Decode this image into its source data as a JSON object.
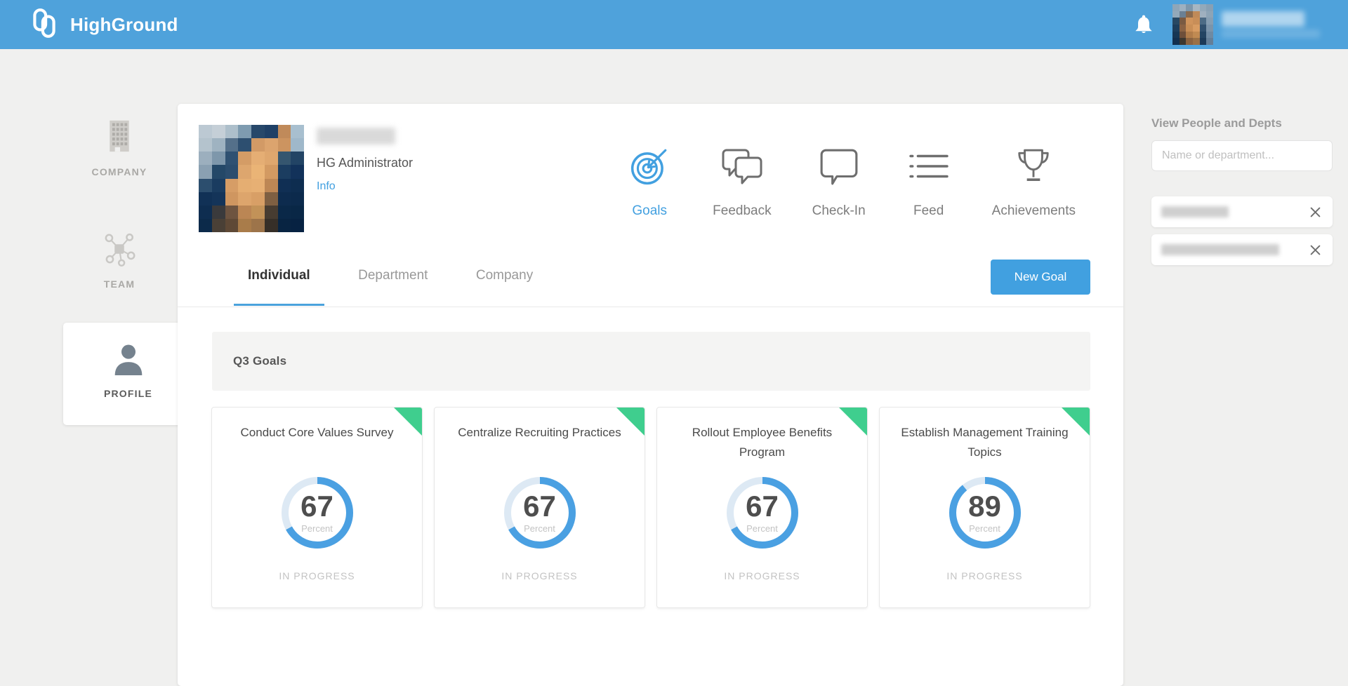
{
  "header": {
    "brand": "HighGround"
  },
  "sidebar": {
    "items": [
      {
        "label": "COMPANY",
        "icon": "building-icon"
      },
      {
        "label": "TEAM",
        "icon": "network-icon"
      },
      {
        "label": "PROFILE",
        "icon": "person-icon",
        "active": true
      }
    ]
  },
  "profile": {
    "role": "HG Administrator",
    "info_link": "Info"
  },
  "profile_nav": {
    "items": [
      {
        "label": "Goals",
        "icon": "target-icon",
        "active": true
      },
      {
        "label": "Feedback",
        "icon": "chat-double-icon"
      },
      {
        "label": "Check-In",
        "icon": "chat-bubble-icon"
      },
      {
        "label": "Feed",
        "icon": "list-icon"
      },
      {
        "label": "Achievements",
        "icon": "trophy-icon"
      }
    ]
  },
  "tabs": {
    "items": [
      {
        "label": "Individual",
        "active": true
      },
      {
        "label": "Department"
      },
      {
        "label": "Company"
      }
    ],
    "new_goal": "New Goal"
  },
  "goals": {
    "section_title": "Q3 Goals",
    "percent_label": "Percent",
    "status_label": "IN PROGRESS",
    "cards": [
      {
        "title": "Conduct Core Values Survey",
        "percent": 67
      },
      {
        "title": "Centralize Recruiting Practices",
        "percent": 67
      },
      {
        "title": "Rollout Employee Benefits Program",
        "percent": 67
      },
      {
        "title": "Establish Management Training Topics",
        "percent": 89
      }
    ]
  },
  "right_panel": {
    "title": "View People and Depts",
    "search_placeholder": "Name or department..."
  },
  "colors": {
    "header_blue": "#4fa2db",
    "accent_blue": "#42a0e0",
    "ring_blue": "#4aa0e2",
    "ring_track": "#dde9f4",
    "flag_green": "#3fce8e"
  },
  "avatars": {
    "profile_mosaic": [
      "#bcc9d3",
      "#c5cfd7",
      "#adbfcb",
      "#7e9bb0",
      "#27486a",
      "#1f4066",
      "#c08a5a",
      "#a8bfcf",
      "#b4c3cd",
      "#9fb3c1",
      "#54708a",
      "#2d4f70",
      "#d29a66",
      "#dca46e",
      "#cc9460",
      "#9fb8ca",
      "#9cafbe",
      "#7e97ab",
      "#2f5172",
      "#d49c66",
      "#e5ae74",
      "#dfa76e",
      "#35566f",
      "#224465",
      "#8aa0b2",
      "#244868",
      "#2b4d6e",
      "#dda66e",
      "#eab476",
      "#d39a62",
      "#1b3d60",
      "#12325a",
      "#2c4e6e",
      "#1a3c60",
      "#d69d66",
      "#e5ae72",
      "#e7b074",
      "#bd8755",
      "#102f54",
      "#0e2d50",
      "#113156",
      "#143459",
      "#cf9660",
      "#dda56c",
      "#d89f66",
      "#7e5f42",
      "#0d2b4e",
      "#0c2a4c",
      "#0e2d50",
      "#3a3a3c",
      "#6e5440",
      "#bb8654",
      "#c29258",
      "#473c31",
      "#0a2848",
      "#092746",
      "#0c2a4a",
      "#4a4036",
      "#5f4936",
      "#a97c4a",
      "#9d744a",
      "#362f28",
      "#082442",
      "#072242"
    ],
    "header_mosaic": [
      "#8fa6b8",
      "#9db0c0",
      "#7d97ac",
      "#a7b6c2",
      "#93a9ba",
      "#88a0b4",
      "#93a9ba",
      "#6b8094",
      "#8a6a4e",
      "#c08a58",
      "#9fb0bf",
      "#8da4b6",
      "#274863",
      "#7a5a42",
      "#d0945c",
      "#c88e58",
      "#4c6b85",
      "#869eb2",
      "#1d3e5c",
      "#8a6244",
      "#c88e56",
      "#d89c62",
      "#30506e",
      "#7b94aa",
      "#163654",
      "#6e4f3a",
      "#b07c4a",
      "#c08a52",
      "#234462",
      "#6f8aa2",
      "#122f4e",
      "#3c3730",
      "#8a6240",
      "#9a7046",
      "#1b3a58",
      "#647f98"
    ]
  }
}
